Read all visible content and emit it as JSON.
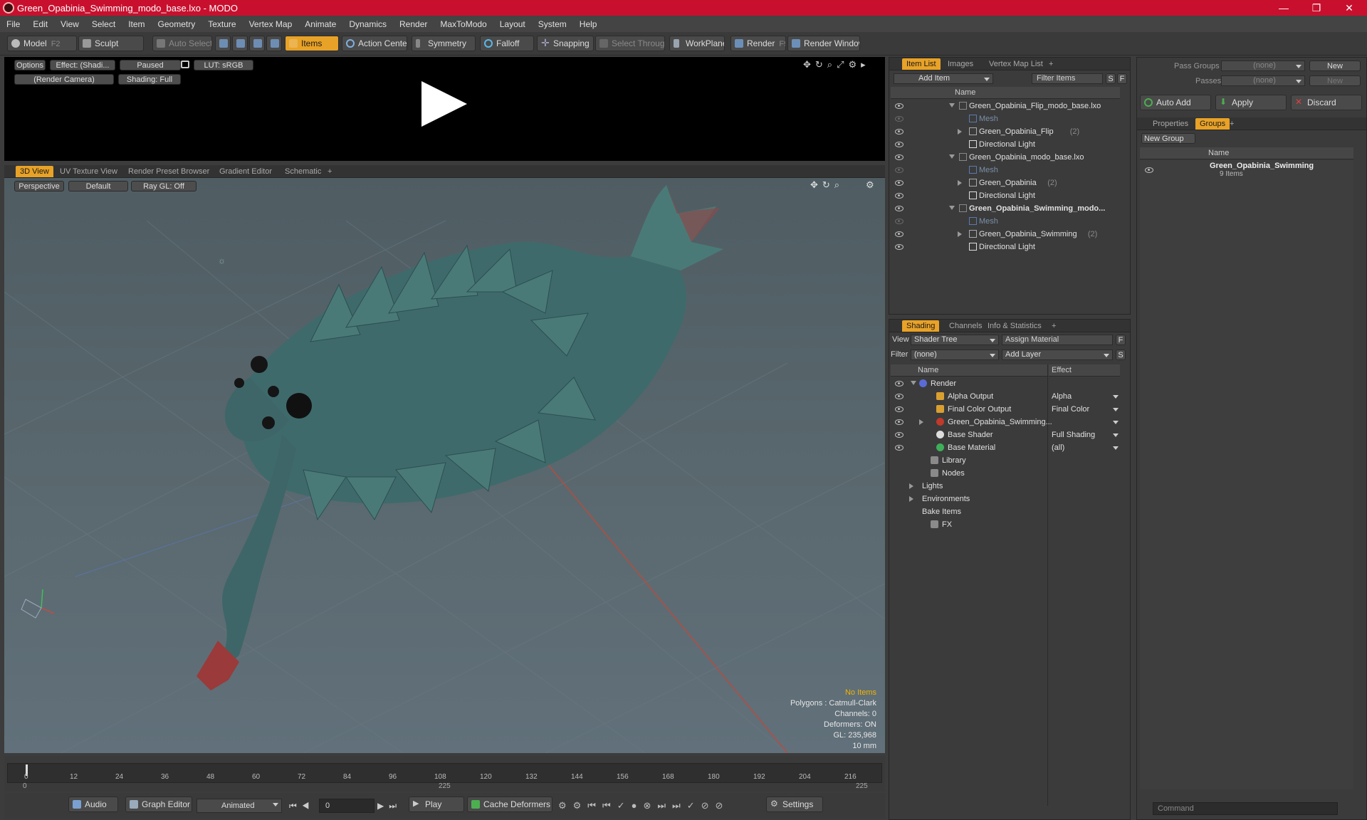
{
  "window": {
    "title": "Green_Opabinia_Swimming_modo_base.lxo - MODO",
    "min": "—",
    "max": "❐",
    "close": "✕"
  },
  "menu": [
    "File",
    "Edit",
    "View",
    "Select",
    "Item",
    "Geometry",
    "Texture",
    "Vertex Map",
    "Animate",
    "Dynamics",
    "Render",
    "MaxToModo",
    "Layout",
    "System",
    "Help"
  ],
  "toolbar": {
    "model": "Model",
    "model_key": "F2",
    "sculpt": "Sculpt",
    "auto_select": "Auto Select",
    "items": "Items",
    "action_center": "Action Center",
    "symmetry": "Symmetry",
    "falloff": "Falloff",
    "snapping": "Snapping",
    "select_through": "Select Through",
    "workplane": "WorkPlane",
    "render": "Render",
    "render_key": "F9",
    "render_window": "Render Window"
  },
  "preview": {
    "options": "Options",
    "effect": "Effect: (Shadi...",
    "paused": "Paused",
    "lut": "LUT: sRGB",
    "camera": "(Render Camera)",
    "shading": "Shading: Full"
  },
  "viewtabs": [
    "3D View",
    "UV Texture View",
    "Render Preset Browser",
    "Gradient Editor",
    "Schematic"
  ],
  "viewport": {
    "perspective": "Perspective",
    "default": "Default",
    "raygl": "Ray GL: Off",
    "info_selected": "No Items",
    "info": [
      "Polygons : Catmull-Clark",
      "Channels: 0",
      "Deformers: ON",
      "GL: 235,968",
      "10 mm"
    ]
  },
  "timeline": {
    "ticks": [
      "0",
      "12",
      "24",
      "36",
      "48",
      "60",
      "72",
      "84",
      "96",
      "108",
      "120",
      "132",
      "144",
      "156",
      "168",
      "180",
      "192",
      "204",
      "216"
    ],
    "start": "0",
    "mid": "225",
    "end": "225"
  },
  "bottom": {
    "audio": "Audio",
    "graph_editor": "Graph Editor",
    "animated": "Animated",
    "frame": "0",
    "play": "Play",
    "cache": "Cache Deformers",
    "settings": "Settings"
  },
  "itemlist": {
    "tabs": [
      "Item List",
      "Images",
      "Vertex Map List"
    ],
    "add_item": "Add Item",
    "filter": "Filter Items",
    "s": "S",
    "f": "F",
    "col_name": "Name",
    "rows": [
      {
        "label": "Green_Opabinia_Flip_modo_base.lxo",
        "count": "",
        "indent": 0,
        "kind": "scene",
        "bold": false
      },
      {
        "label": "Mesh",
        "count": "",
        "indent": 1,
        "kind": "mesh",
        "bold": false
      },
      {
        "label": "Green_Opabinia_Flip",
        "count": "(2)",
        "indent": 1,
        "kind": "group",
        "bold": false
      },
      {
        "label": "Directional Light",
        "count": "",
        "indent": 1,
        "kind": "light",
        "bold": false
      },
      {
        "label": "Green_Opabinia_modo_base.lxo",
        "count": "",
        "indent": 0,
        "kind": "scene",
        "bold": false
      },
      {
        "label": "Mesh",
        "count": "",
        "indent": 1,
        "kind": "mesh",
        "bold": false
      },
      {
        "label": "Green_Opabinia",
        "count": "(2)",
        "indent": 1,
        "kind": "group",
        "bold": false
      },
      {
        "label": "Directional Light",
        "count": "",
        "indent": 1,
        "kind": "light",
        "bold": false
      },
      {
        "label": "Green_Opabinia_Swimming_modo...",
        "count": "",
        "indent": 0,
        "kind": "scene",
        "bold": true
      },
      {
        "label": "Mesh",
        "count": "",
        "indent": 1,
        "kind": "mesh",
        "bold": false
      },
      {
        "label": "Green_Opabinia_Swimming",
        "count": "(2)",
        "indent": 1,
        "kind": "group",
        "bold": false
      },
      {
        "label": "Directional Light",
        "count": "",
        "indent": 1,
        "kind": "light",
        "bold": false
      }
    ]
  },
  "shading": {
    "tabs": [
      "Shading",
      "Channels",
      "Info & Statistics"
    ],
    "view_label": "View",
    "view_value": "Shader Tree",
    "assign": "Assign Material",
    "f": "F",
    "filter_label": "Filter",
    "filter_value": "(none)",
    "add_layer": "Add Layer",
    "s": "S",
    "col_name": "Name",
    "col_effect": "Effect",
    "rows": [
      {
        "label": "Render",
        "effect": "",
        "indent": 0,
        "color": "#5a6bd6"
      },
      {
        "label": "Alpha Output",
        "effect": "Alpha",
        "indent": 1,
        "color": "#d9a030"
      },
      {
        "label": "Final Color Output",
        "effect": "Final Color",
        "indent": 1,
        "color": "#d9a030"
      },
      {
        "label": "Green_Opabinia_Swimming...",
        "effect": "",
        "indent": 1,
        "color": "#c0392b"
      },
      {
        "label": "Base Shader",
        "effect": "Full Shading",
        "indent": 1,
        "color": "#dddddd"
      },
      {
        "label": "Base Material",
        "effect": "(all)",
        "indent": 1,
        "color": "#3fae5a"
      },
      {
        "label": "Library",
        "effect": "",
        "indent": 0,
        "color": "#8a8a8a"
      },
      {
        "label": "Nodes",
        "effect": "",
        "indent": 0,
        "color": "#8a8a8a"
      },
      {
        "label": "Lights",
        "effect": "",
        "indent": -1,
        "color": ""
      },
      {
        "label": "Environments",
        "effect": "",
        "indent": -1,
        "color": ""
      },
      {
        "label": "Bake Items",
        "effect": "",
        "indent": -1,
        "color": ""
      },
      {
        "label": "FX",
        "effect": "",
        "indent": 0,
        "color": "#8a8a8a"
      }
    ]
  },
  "groups": {
    "pass_groups": "Pass Groups",
    "passes": "Passes",
    "none": "(none)",
    "new": "New",
    "auto_add": "Auto Add",
    "apply": "Apply",
    "discard": "Discard",
    "tabs": [
      "Properties",
      "Groups"
    ],
    "new_group": "New Group",
    "col_name": "Name",
    "group_name": "Green_Opabinia_Swimming",
    "group_count": "9 Items",
    "command": "Command"
  }
}
